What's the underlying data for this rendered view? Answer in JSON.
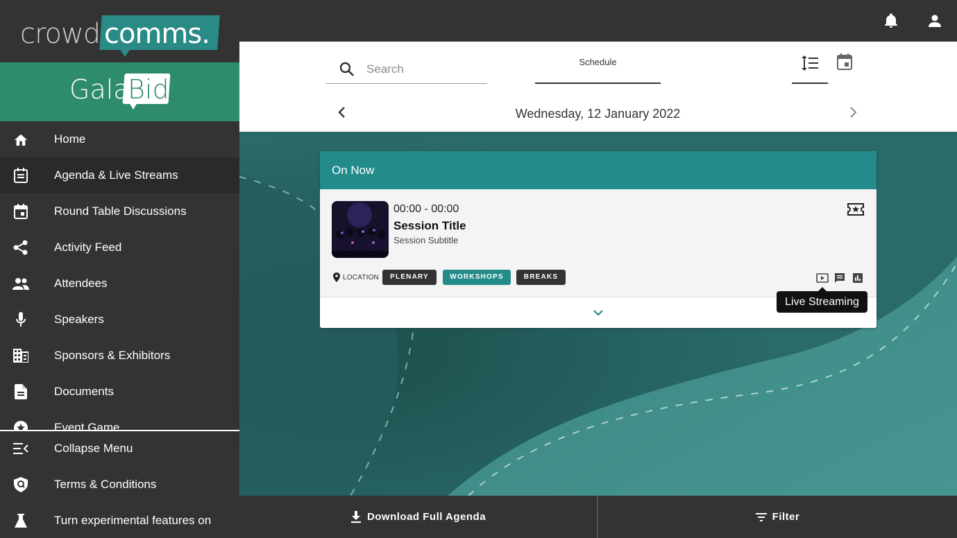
{
  "brand": {
    "logo_part1": "crowd",
    "logo_part2": "comms.",
    "event_part1": "Gala",
    "event_part2": "Bid"
  },
  "sidebar": {
    "items": [
      {
        "label": "Home",
        "icon": "home-icon"
      },
      {
        "label": "Agenda & Live Streams",
        "icon": "agenda-icon",
        "active": true
      },
      {
        "label": "Round Table Discussions",
        "icon": "calendar-event-icon"
      },
      {
        "label": "Activity Feed",
        "icon": "share-icon"
      },
      {
        "label": "Attendees",
        "icon": "people-icon"
      },
      {
        "label": "Speakers",
        "icon": "microphone-icon"
      },
      {
        "label": "Sponsors & Exhibitors",
        "icon": "building-icon"
      },
      {
        "label": "Documents",
        "icon": "document-icon"
      },
      {
        "label": "Event Game",
        "icon": "star-icon"
      }
    ],
    "bottom_items": [
      {
        "label": "Collapse Menu",
        "icon": "collapse-menu-icon"
      },
      {
        "label": "Terms & Conditions",
        "icon": "shield-icon"
      },
      {
        "label": "Turn experimental features on",
        "icon": "flask-icon"
      }
    ]
  },
  "topbar": {
    "icons": [
      "bell-icon",
      "account-icon"
    ]
  },
  "header": {
    "search_placeholder": "Search",
    "tab_schedule": "Schedule",
    "date_label": "Wednesday, 12 January 2022"
  },
  "card": {
    "header_title": "On Now",
    "time": "00:00 - 00:00",
    "title": "Session Title",
    "subtitle": "Session Subtitle",
    "location": "LOCATION",
    "tags": [
      {
        "label": "PLENARY",
        "color": "#333333"
      },
      {
        "label": "WORKSHOPS",
        "color": "#238c8a"
      },
      {
        "label": "BREAKS",
        "color": "#333333"
      }
    ],
    "tooltip": "Live Streaming"
  },
  "bottombar": {
    "download_label": "Download Full Agenda",
    "filter_label": "Filter"
  },
  "colors": {
    "sidebar_bg": "#333333",
    "brand_green": "#2e8b6b",
    "teal": "#238c8a",
    "main_bg": "#2d6f6d"
  }
}
